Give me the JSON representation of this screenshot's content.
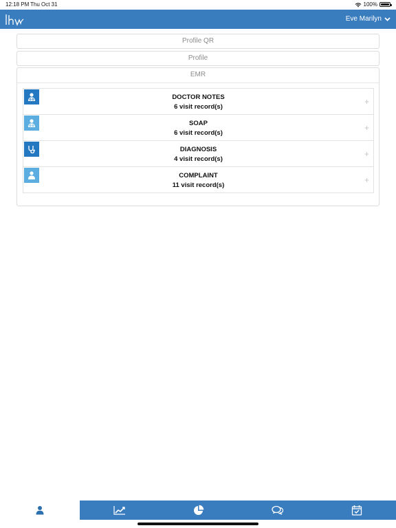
{
  "status_bar": {
    "time": "12:18 PM",
    "date": "Thu Oct 31",
    "battery": "100%"
  },
  "header": {
    "user_name": "Eve Marilyn",
    "accent_color": "#3a7dbf"
  },
  "sections": {
    "profile_qr": "Profile QR",
    "profile": "Profile",
    "emr": "EMR"
  },
  "emr_records": [
    {
      "title": "DOCTOR NOTES",
      "subtitle": "6 visit record(s)",
      "icon": "doctor-icon",
      "icon_color": "#2378c1"
    },
    {
      "title": "SOAP",
      "subtitle": "6 visit record(s)",
      "icon": "doctor-icon",
      "icon_color": "#5daee0"
    },
    {
      "title": "DIAGNOSIS",
      "subtitle": "4 visit record(s)",
      "icon": "stethoscope-icon",
      "icon_color": "#2378c1"
    },
    {
      "title": "COMPLAINT",
      "subtitle": "11 visit record(s)",
      "icon": "person-icon",
      "icon_color": "#5daee0"
    }
  ],
  "expand_symbol": "+",
  "tabs": [
    {
      "name": "profile",
      "icon": "person-icon",
      "active": true
    },
    {
      "name": "trends",
      "icon": "line-chart-icon",
      "active": false
    },
    {
      "name": "reports",
      "icon": "pie-chart-icon",
      "active": false
    },
    {
      "name": "messages",
      "icon": "chat-bubbles-icon",
      "active": false
    },
    {
      "name": "appointments",
      "icon": "calendar-check-icon",
      "active": false
    }
  ]
}
